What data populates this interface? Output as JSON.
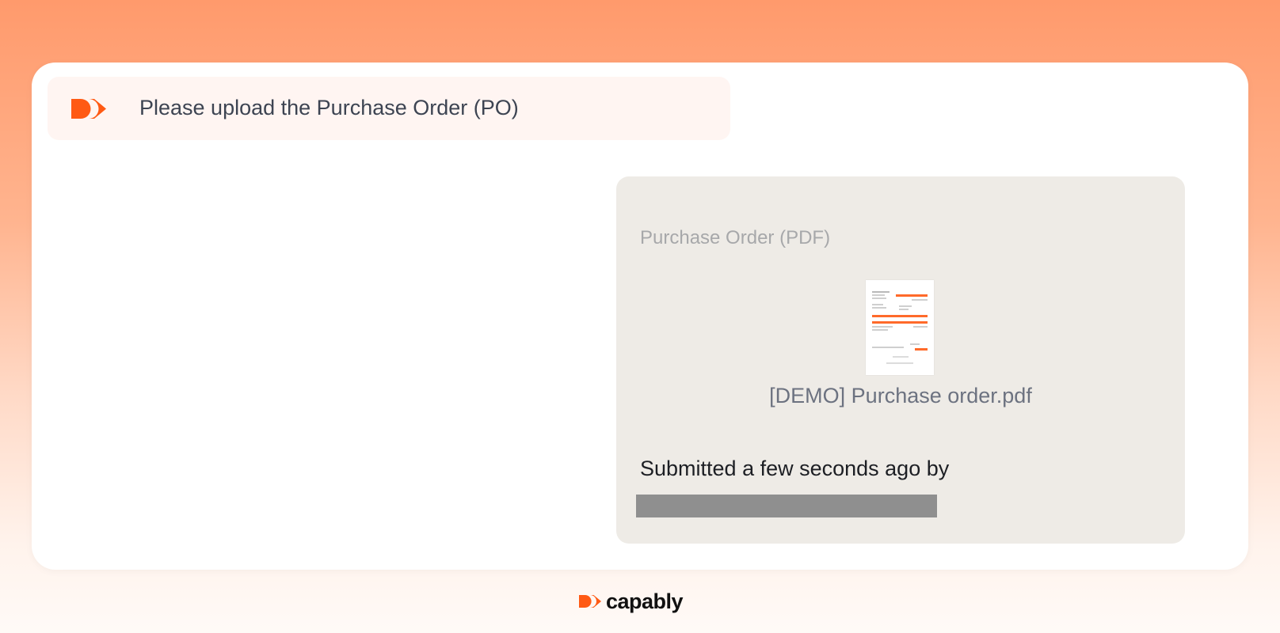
{
  "prompt": {
    "text": "Please upload the Purchase Order (PO)",
    "icon": "capably-logo-icon"
  },
  "submission": {
    "field_label": "Purchase Order (PDF)",
    "file": {
      "name": "[DEMO] Purchase order.pdf",
      "icon": "pdf-thumbnail-icon"
    },
    "submitted_text": "Submitted a few seconds ago by"
  },
  "footer": {
    "brand": "capably",
    "icon": "capably-logo-icon"
  },
  "colors": {
    "accent": "#ff5a14",
    "prompt_bg": "#fff5f2",
    "panel_bg": "#eeebe6",
    "redaction": "#8f8f8f"
  }
}
